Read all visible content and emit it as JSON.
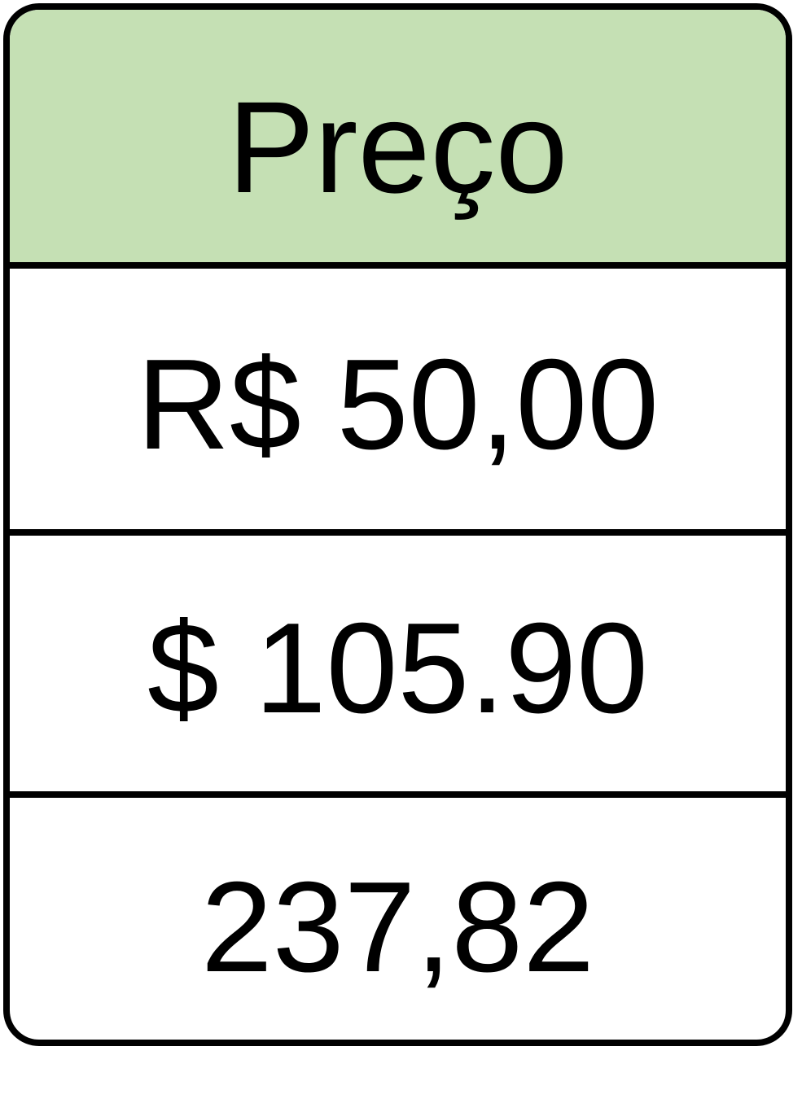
{
  "table": {
    "header": "Preço",
    "rows": [
      "R$ 50,00",
      "$ 105.90",
      "237,82"
    ]
  },
  "colors": {
    "header_background": "#c5e0b4",
    "border": "#000000",
    "cell_background": "#ffffff",
    "text": "#000000"
  }
}
